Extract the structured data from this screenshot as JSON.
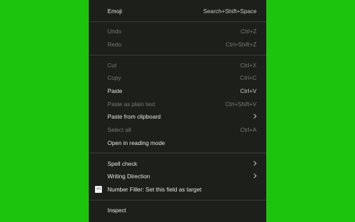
{
  "menu": {
    "emoji": {
      "label": "Emoji",
      "shortcut": "Search+Shift+Space"
    },
    "undo": {
      "label": "Undo",
      "shortcut": "Ctrl+Z"
    },
    "redo": {
      "label": "Redo",
      "shortcut": "Ctrl+Shift+Z"
    },
    "cut": {
      "label": "Cut",
      "shortcut": "Ctrl+X"
    },
    "copy": {
      "label": "Copy",
      "shortcut": "Ctrl+C"
    },
    "paste": {
      "label": "Paste",
      "shortcut": "Ctrl+V"
    },
    "paste_plain": {
      "label": "Paste as plain text",
      "shortcut": "Ctrl+Shift+V"
    },
    "paste_clipboard": {
      "label": "Paste from clipboard"
    },
    "select_all": {
      "label": "Select all",
      "shortcut": "Ctrl+A"
    },
    "reading_mode": {
      "label": "Open in reading mode"
    },
    "spell_check": {
      "label": "Spell check"
    },
    "writing_direction": {
      "label": "Writing Direction"
    },
    "number_filler": {
      "label": "Number Filler: Set this field as target",
      "icon": "number-filler-extension-icon"
    },
    "inspect": {
      "label": "Inspect"
    }
  },
  "colors": {
    "background": "#1dc40d",
    "menu_background": "#1d1f1b",
    "enabled_text": "#e7e9e5",
    "disabled_text": "#777b76",
    "separator": "#3a3d38"
  }
}
